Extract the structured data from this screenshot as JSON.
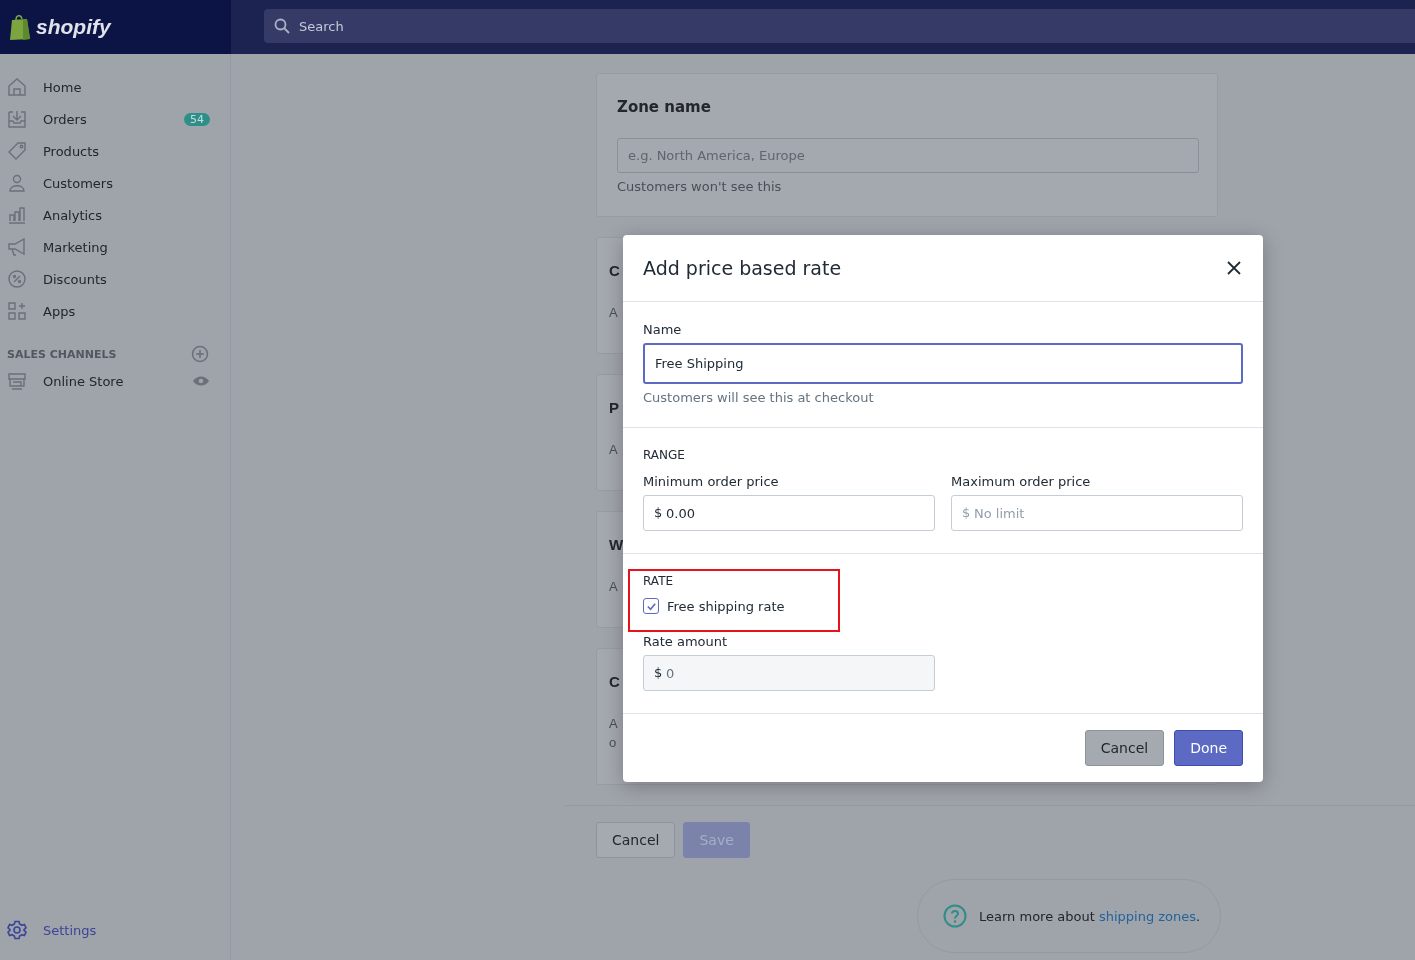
{
  "topbar": {
    "logo": "shopify",
    "search": {
      "placeholder": "Search"
    }
  },
  "sidebar": {
    "items": [
      {
        "label": "Home",
        "selected": false
      },
      {
        "label": "Orders",
        "badge": "54",
        "selected": false
      },
      {
        "label": "Products",
        "selected": false
      },
      {
        "label": "Customers",
        "selected": false
      },
      {
        "label": "Analytics",
        "selected": false
      },
      {
        "label": "Marketing",
        "selected": false
      },
      {
        "label": "Discounts",
        "selected": false
      },
      {
        "label": "Apps",
        "selected": false
      }
    ],
    "section_title": "SALES CHANNELS",
    "channels": [
      {
        "label": "Online Store",
        "selected": false
      }
    ],
    "settings": {
      "label": "Settings",
      "selected": true
    }
  },
  "zone_card": {
    "title": "Zone name",
    "field": {
      "placeholder": "e.g. North America, Europe"
    },
    "help": "Customers won't see this"
  },
  "hidden_cards": [
    {
      "title": "C",
      "lines": [
        "A"
      ]
    },
    {
      "title": "P",
      "lines": [
        "A"
      ]
    },
    {
      "title": "W",
      "lines": [
        "A"
      ]
    },
    {
      "title": "C",
      "lines": [
        "A",
        "o"
      ]
    }
  ],
  "page_actions": {
    "cancel": "Cancel",
    "save": "Save",
    "save_disabled": true
  },
  "help": {
    "text": "Learn more about ",
    "link": "shipping zones",
    "after": "."
  },
  "modal": {
    "title": "Add price based rate",
    "name": {
      "label": "Name",
      "value": "Free Shipping",
      "help": "Customers will see this at checkout"
    },
    "range": {
      "heading": "RANGE",
      "min": {
        "label": "Minimum order price",
        "prefix": "$",
        "value": "0.00"
      },
      "max": {
        "label": "Maximum order price",
        "prefix": "$",
        "placeholder": "No limit"
      }
    },
    "rate": {
      "heading": "RATE",
      "highlighted": true,
      "free": {
        "label": "Free shipping rate",
        "checked": true
      },
      "amount": {
        "label": "Rate amount",
        "prefix": "$",
        "value": "0",
        "disabled": true
      }
    },
    "buttons": {
      "cancel": "Cancel",
      "done": "Done"
    }
  }
}
